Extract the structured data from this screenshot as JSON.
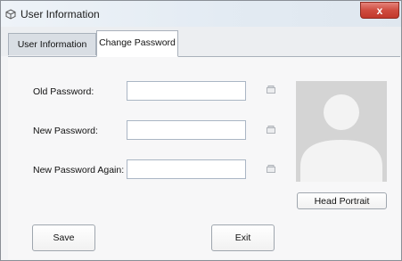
{
  "window": {
    "title": "User Information",
    "close_label": "x"
  },
  "tabs": [
    {
      "label": "User Information",
      "active": false
    },
    {
      "label": "Change Password",
      "active": true
    }
  ],
  "form": {
    "old_password": {
      "label": "Old Password:",
      "value": ""
    },
    "new_password": {
      "label": "New Password:",
      "value": ""
    },
    "new_password_again": {
      "label": "New Password Again:",
      "value": ""
    }
  },
  "portrait": {
    "button_label": "Head Portrait"
  },
  "actions": {
    "save_label": "Save",
    "exit_label": "Exit"
  },
  "colors": {
    "close_button": "#c2392c",
    "portrait_background": "#d4d4d4",
    "field_border": "#aab6c4"
  }
}
